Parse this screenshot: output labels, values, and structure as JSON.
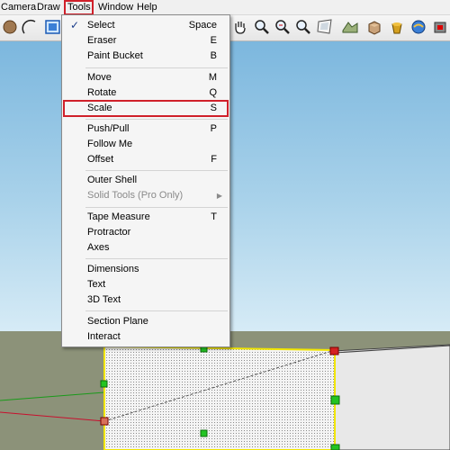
{
  "menubar": {
    "items": [
      {
        "label": "Camera"
      },
      {
        "label": "Draw"
      },
      {
        "label": "Tools"
      },
      {
        "label": "Window"
      },
      {
        "label": "Help"
      }
    ],
    "highlighted": "Tools"
  },
  "toolbar": {
    "left_icons": [
      "circle-icon",
      "arc-icon",
      "follow-me-box-icon"
    ],
    "right_icons": [
      "pan-hand-icon",
      "zoom-magnifier-icon",
      "zoom-extents-icon",
      "add-location-icon",
      "components-icon",
      "materials-bucket-icon",
      "3d-warehouse-icon",
      "extension-icon"
    ]
  },
  "tools_menu": {
    "items": [
      {
        "label": "Select",
        "shortcut": "Space",
        "checked": true
      },
      {
        "label": "Eraser",
        "shortcut": "E"
      },
      {
        "label": "Paint Bucket",
        "shortcut": "B"
      },
      {
        "label": "Move",
        "shortcut": "M"
      },
      {
        "label": "Rotate",
        "shortcut": "Q"
      },
      {
        "label": "Scale",
        "shortcut": "S",
        "highlighted": true
      },
      {
        "label": "Push/Pull",
        "shortcut": "P"
      },
      {
        "label": "Follow Me",
        "shortcut": ""
      },
      {
        "label": "Offset",
        "shortcut": "F"
      },
      {
        "label": "Outer Shell",
        "shortcut": ""
      },
      {
        "label": "Solid Tools (Pro Only)",
        "shortcut": "",
        "disabled": true,
        "submenu": true
      },
      {
        "label": "Tape Measure",
        "shortcut": "T"
      },
      {
        "label": "Protractor",
        "shortcut": ""
      },
      {
        "label": "Axes",
        "shortcut": ""
      },
      {
        "label": "Dimensions",
        "shortcut": ""
      },
      {
        "label": "Text",
        "shortcut": ""
      },
      {
        "label": "3D Text",
        "shortcut": ""
      },
      {
        "label": "Section Plane",
        "shortcut": ""
      },
      {
        "label": "Interact",
        "shortcut": ""
      }
    ]
  },
  "colors": {
    "highlight_border": "#d0202a",
    "sky_top": "#7cb7de",
    "ground": "#8c9279",
    "selection_yellow": "#f2e600",
    "grip_green": "#22c422",
    "grip_red": "#d42222"
  }
}
